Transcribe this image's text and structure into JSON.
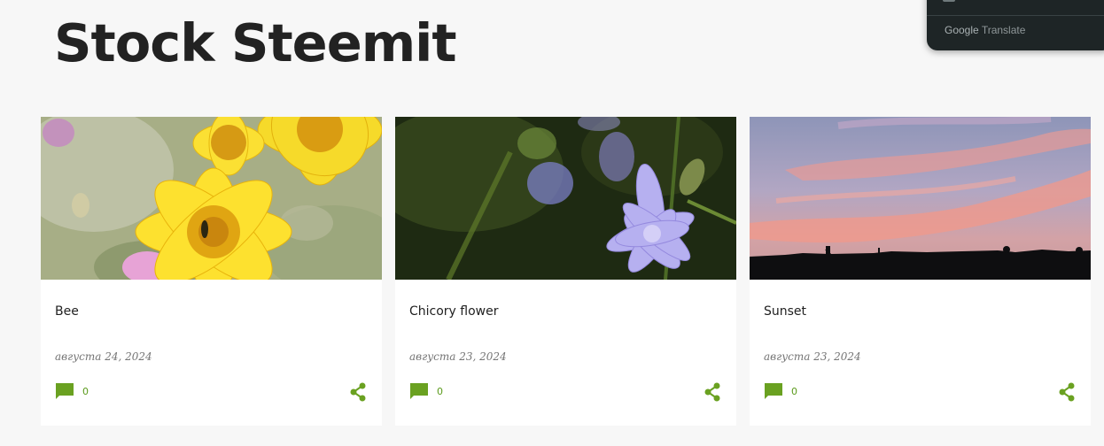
{
  "blog": {
    "title": "Stock Steemit"
  },
  "translate_popup": {
    "attribution_brand": "Google",
    "attribution_service": "Translate"
  },
  "theme": {
    "accent": "#6aa121",
    "title_color": "#222222",
    "date_color": "#757575"
  },
  "posts": [
    {
      "title": "Bee",
      "date": "августа 24, 2024",
      "comments": "0",
      "image": "yellow-flowers-with-bee"
    },
    {
      "title": "Chicory flower",
      "date": "августа 23, 2024",
      "comments": "0",
      "image": "purple-chicory-flower"
    },
    {
      "title": "Sunset",
      "date": "августа 23, 2024",
      "comments": "0",
      "image": "sunset-sky-silhouette"
    }
  ]
}
